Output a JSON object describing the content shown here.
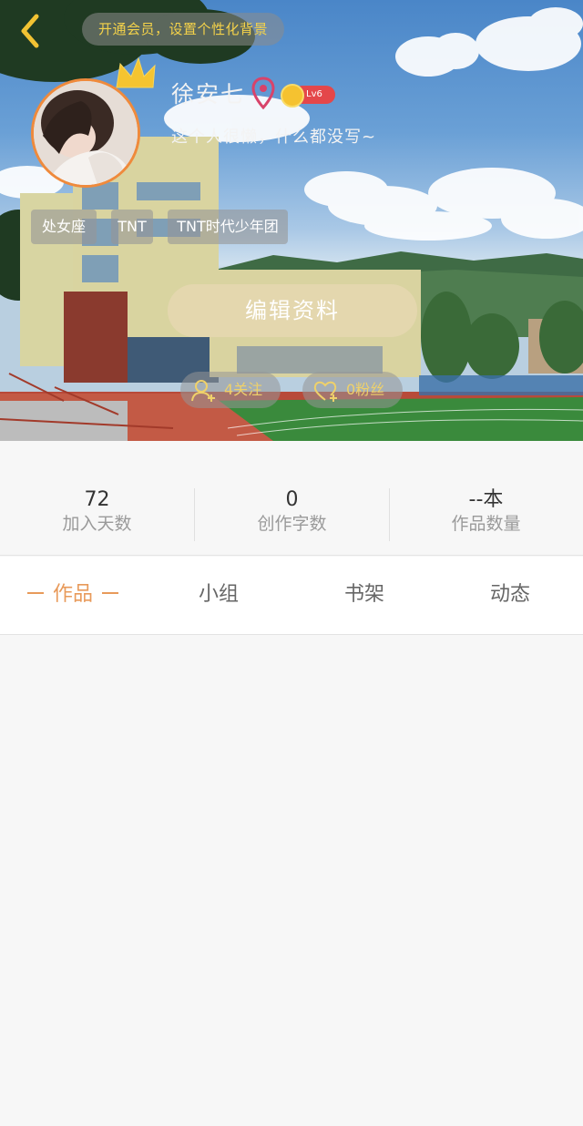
{
  "header": {
    "vip_banner": "开通会员，设置个性化背景",
    "username": "徐安七",
    "level": "Lv6",
    "bio": "这个人很懒，什么都没写~",
    "tags": [
      "处女座",
      "TNT",
      "TNT时代少年团"
    ],
    "edit_button": "编辑资料",
    "following": "4关注",
    "followers": "0粉丝"
  },
  "stats": [
    {
      "value": "72",
      "label": "加入天数"
    },
    {
      "value": "0",
      "label": "创作字数"
    },
    {
      "value": "--本",
      "label": "作品数量"
    }
  ],
  "tabs": [
    {
      "label": "作品",
      "active": true
    },
    {
      "label": "小组",
      "active": false
    },
    {
      "label": "书架",
      "active": false
    },
    {
      "label": "动态",
      "active": false
    }
  ],
  "colors": {
    "accent_orange": "#e89a5a",
    "gold_text": "#f4d24a",
    "edit_button_bg": "#e4d7ae",
    "level_badge": "#e4474a",
    "avatar_border": "#ef8a3c"
  },
  "icons": [
    "back-arrow-icon",
    "crown-icon",
    "location-pin-icon",
    "level-coin-icon",
    "user-add-icon",
    "heart-add-icon"
  ]
}
